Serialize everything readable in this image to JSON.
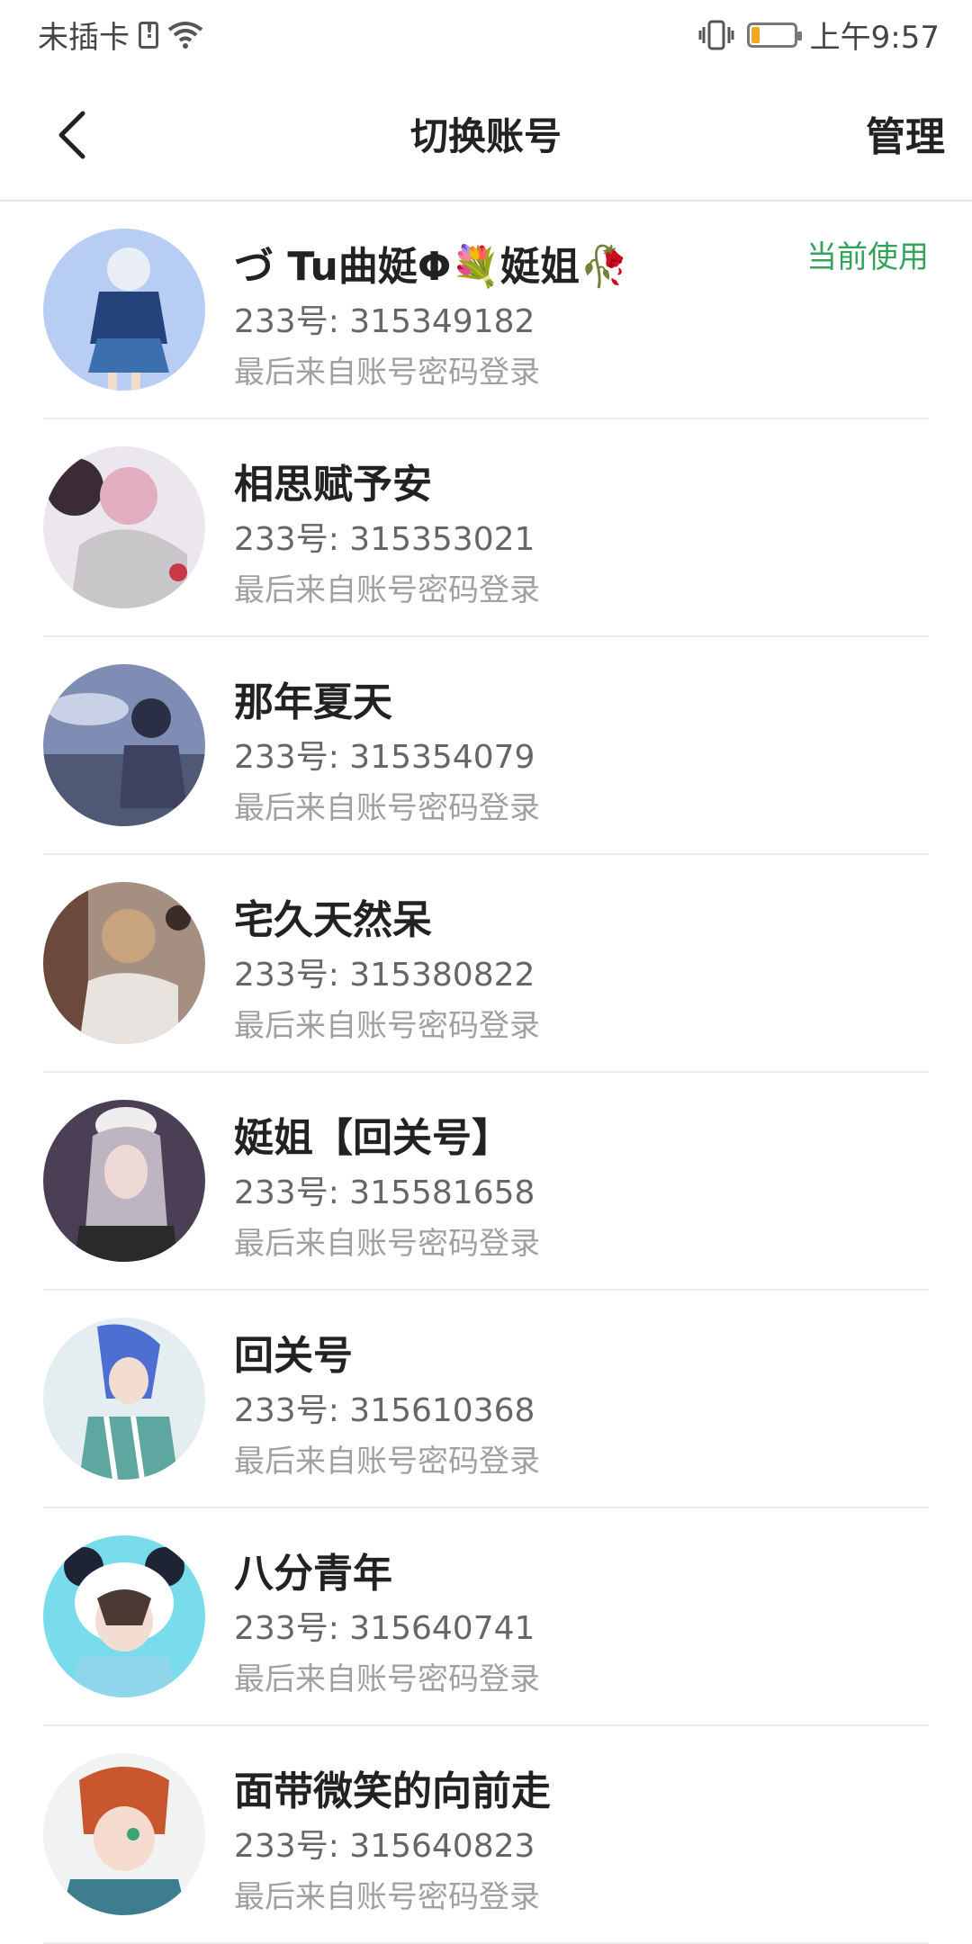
{
  "status_bar": {
    "carrier": "未插卡",
    "time": "上午9:57",
    "battery_level": 0.2,
    "battery_color": "#f5a623"
  },
  "header": {
    "title": "切换账号",
    "manage_label": "管理",
    "back_icon": "chevron-left-icon"
  },
  "accounts": [
    {
      "name": "づ Tu曲娗Φ💐娗姐🥀",
      "id": "233号: 315349182",
      "last_login": "最后来自账号密码登录",
      "current_label": "当前使用"
    },
    {
      "name": "相思赋予安",
      "id": "233号: 315353021",
      "last_login": "最后来自账号密码登录"
    },
    {
      "name": "那年夏天",
      "id": "233号: 315354079",
      "last_login": "最后来自账号密码登录"
    },
    {
      "name": "宅久天然呆",
      "id": "233号: 315380822",
      "last_login": "最后来自账号密码登录"
    },
    {
      "name": "娗姐【回关号】",
      "id": "233号: 315581658",
      "last_login": "最后来自账号密码登录"
    },
    {
      "name": "回关号",
      "id": "233号: 315610368",
      "last_login": "最后来自账号密码登录"
    },
    {
      "name": "八分青年",
      "id": "233号: 315640741",
      "last_login": "最后来自账号密码登录"
    },
    {
      "name": "面带微笑的向前走",
      "id": "233号: 315640823",
      "last_login": "最后来自账号密码登录"
    }
  ],
  "colors": {
    "accent_current": "#35a35a"
  }
}
